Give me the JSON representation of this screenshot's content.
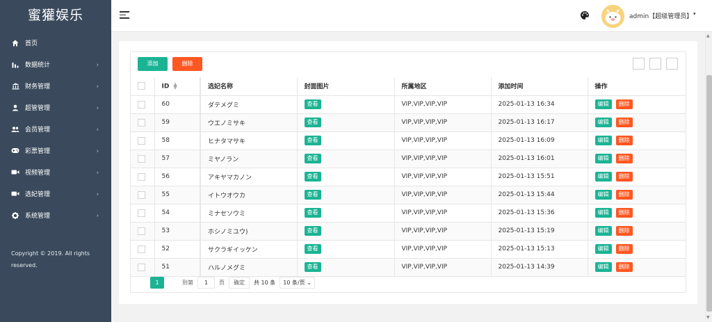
{
  "brand": "蜜獾娱乐",
  "sidebar": {
    "items": [
      {
        "label": "首页",
        "icon": "home-icon",
        "has_arrow": false
      },
      {
        "label": "数据统计",
        "icon": "bar-chart-icon",
        "has_arrow": true
      },
      {
        "label": "财务管理",
        "icon": "bank-icon",
        "has_arrow": true
      },
      {
        "label": "超管管理",
        "icon": "user-icon",
        "has_arrow": true
      },
      {
        "label": "会员管理",
        "icon": "users-icon",
        "has_arrow": true
      },
      {
        "label": "彩票管理",
        "icon": "gamepad-icon",
        "has_arrow": true
      },
      {
        "label": "视频管理",
        "icon": "video-icon",
        "has_arrow": true
      },
      {
        "label": "选妃管理",
        "icon": "video-icon",
        "has_arrow": true
      },
      {
        "label": "系统管理",
        "icon": "gear-icon",
        "has_arrow": true
      }
    ],
    "arrow": "›",
    "copyright": "Copyright © 2019. All rights reserved."
  },
  "header": {
    "user_name": "admin【超级管理员】",
    "caret": "▾"
  },
  "toolbar": {
    "add_label": "添加",
    "delete_label": "删除"
  },
  "table": {
    "headers": {
      "id": "ID",
      "name": "选妃名称",
      "cover": "封面图片",
      "region": "所属地区",
      "time": "添加时间",
      "actions": "操作"
    },
    "view_label": "查看",
    "edit_label": "编辑",
    "delete_label": "删除",
    "rows": [
      {
        "id": "60",
        "name": "ダテメグミ",
        "region": "VIP,VIP,VIP,VIP",
        "time": "2025-01-13 16:34"
      },
      {
        "id": "59",
        "name": "ウエノミサキ",
        "region": "VIP,VIP,VIP,VIP",
        "time": "2025-01-13 16:17"
      },
      {
        "id": "58",
        "name": "ヒナタマサキ",
        "region": "VIP,VIP,VIP,VIP",
        "time": "2025-01-13 16:09"
      },
      {
        "id": "57",
        "name": "ミヤノラン",
        "region": "VIP,VIP,VIP,VIP",
        "time": "2025-01-13 16:01"
      },
      {
        "id": "56",
        "name": "アキヤマカノン",
        "region": "VIP,VIP,VIP,VIP",
        "time": "2025-01-13 15:51"
      },
      {
        "id": "55",
        "name": "イトウオウカ",
        "region": "VIP,VIP,VIP,VIP",
        "time": "2025-01-13 15:44"
      },
      {
        "id": "54",
        "name": "ミナセソウミ",
        "region": "VIP,VIP,VIP,VIP",
        "time": "2025-01-13 15:36"
      },
      {
        "id": "53",
        "name": "ホシノミユウ)",
        "region": "VIP,VIP,VIP,VIP",
        "time": "2025-01-13 15:19"
      },
      {
        "id": "52",
        "name": "サクラギイッケン",
        "region": "VIP,VIP,VIP,VIP",
        "time": "2025-01-13 15:13"
      },
      {
        "id": "51",
        "name": "ハルノメグミ",
        "region": "VIP,VIP,VIP,VIP",
        "time": "2025-01-13 14:39"
      }
    ]
  },
  "pagination": {
    "current_page": "1",
    "goto_label": "到第",
    "page_input_value": "1",
    "page_label": "页",
    "confirm_label": "确定",
    "total_label": "共 10 条",
    "page_size_label": "10 条/页"
  },
  "colors": {
    "sidebar_bg": "#3a4a5c",
    "primary_green": "#1bb394",
    "danger_orange": "#ff5722",
    "page_bg": "#f2f2f2"
  }
}
